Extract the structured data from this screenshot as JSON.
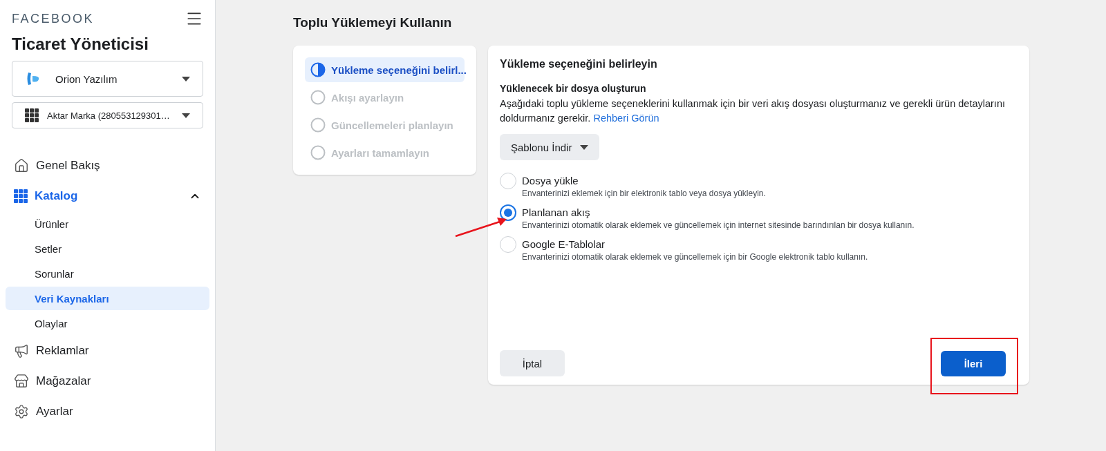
{
  "sidebar": {
    "brand": "FACEBOOK",
    "title": "Ticaret Yöneticisi",
    "business_selector": {
      "value": "Orion Yazılım"
    },
    "catalog_selector": {
      "value": "Aktar Marka (280553129301…"
    },
    "nav": [
      {
        "label": "Genel Bakış",
        "kind": "home",
        "selected": false
      },
      {
        "label": "Katalog",
        "kind": "catalog",
        "selected": true,
        "expanded": true,
        "children": [
          {
            "label": "Ürünler",
            "selected": false
          },
          {
            "label": "Setler",
            "selected": false
          },
          {
            "label": "Sorunlar",
            "selected": false
          },
          {
            "label": "Veri Kaynakları",
            "selected": true
          },
          {
            "label": "Olaylar",
            "selected": false
          }
        ]
      },
      {
        "label": "Reklamlar",
        "kind": "ads",
        "selected": false
      },
      {
        "label": "Mağazalar",
        "kind": "shops",
        "selected": false
      },
      {
        "label": "Ayarlar",
        "kind": "settings",
        "selected": false
      }
    ]
  },
  "main": {
    "title": "Toplu Yüklemeyi Kullanın",
    "steps": [
      {
        "label": "Yükleme seçeneğini belirl...",
        "selected": true
      },
      {
        "label": "Akışı ayarlayın",
        "selected": false
      },
      {
        "label": "Güncellemeleri planlayın",
        "selected": false
      },
      {
        "label": "Ayarları tamamlayın",
        "selected": false
      }
    ],
    "panel": {
      "heading": "Yükleme seçeneğini belirleyin",
      "subheading": "Yüklenecek bir dosya oluşturun",
      "description": "Aşağıdaki toplu yükleme seçeneklerini kullanmak için bir veri akış dosyası oluşturmanız ve gerekli ürün detaylarını doldurmanız gerekir.",
      "link": "Rehberi Görün",
      "template_button": "Şablonu İndir",
      "options": [
        {
          "label": "Dosya yükle",
          "description": "Envanterinizi eklemek için bir elektronik tablo veya dosya yükleyin.",
          "selected": false
        },
        {
          "label": "Planlanan akış",
          "description": "Envanterinizi otomatik olarak eklemek ve güncellemek için internet sitesinde barındırılan bir dosya kullanın.",
          "selected": true
        },
        {
          "label": "Google E-Tablolar",
          "description": "Envanterinizi otomatik olarak eklemek ve güncellemek için bir Google elektronik tablo kullanın.",
          "selected": false
        }
      ],
      "cancel_button": "İptal",
      "next_button": "İleri"
    }
  },
  "annotations": {
    "arrow": true,
    "highlight_box": true
  }
}
